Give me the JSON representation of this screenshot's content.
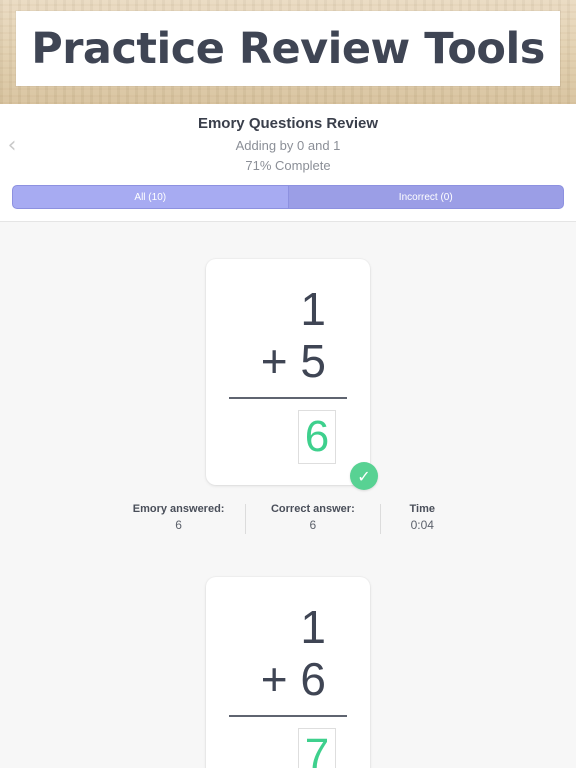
{
  "banner": {
    "title": "Practice Review Tools"
  },
  "header": {
    "title": "Emory Questions Review",
    "subtitle": "Adding by 0 and 1",
    "progress": "71% Complete",
    "tabs": [
      {
        "label": "All (10)",
        "active": true
      },
      {
        "label": "Incorrect (0)",
        "active": false
      }
    ]
  },
  "problems": [
    {
      "top": "1",
      "operator_line": "+ 5",
      "answer": "6",
      "correct": true,
      "stats": {
        "answered_label": "Emory answered:",
        "answered_value": "6",
        "correct_label": "Correct answer:",
        "correct_value": "6",
        "time_label": "Time",
        "time_value": "0:04"
      }
    },
    {
      "top": "1",
      "operator_line": "+ 6",
      "answer": "7"
    }
  ],
  "icons": {
    "back": "chevron-left-icon",
    "check": "check-icon"
  },
  "colors": {
    "accent": "#a7abf2",
    "correct": "#3ed08d",
    "text": "#3f4554"
  }
}
